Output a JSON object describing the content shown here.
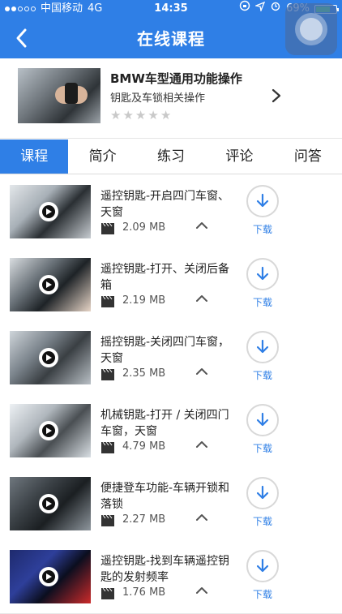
{
  "status_bar": {
    "carrier": "中国移动",
    "network": "4G",
    "time": "14:35",
    "battery": "69%",
    "battery_level": 0.69
  },
  "nav": {
    "title": "在线课程"
  },
  "course": {
    "title": "BMW车型通用功能操作",
    "subtitle": "钥匙及车锁相关操作",
    "rating": 0,
    "stars": [
      "★",
      "★",
      "★",
      "★",
      "★"
    ]
  },
  "tabs": [
    {
      "label": "课程",
      "active": true
    },
    {
      "label": "简介",
      "active": false
    },
    {
      "label": "练习",
      "active": false
    },
    {
      "label": "评论",
      "active": false
    },
    {
      "label": "问答",
      "active": false
    }
  ],
  "lessons": [
    {
      "title": "遥控钥匙-开启四门车窗、天窗",
      "size": "2.09 MB",
      "download_label": "下载"
    },
    {
      "title": "遥控钥匙-打开、关闭后备箱",
      "size": "2.19 MB",
      "download_label": "下载"
    },
    {
      "title": "摇控钥匙-关闭四门车窗，天窗",
      "size": "2.35 MB",
      "download_label": "下载"
    },
    {
      "title": "机械钥匙-打开 / 关闭四门车窗，天窗",
      "size": "4.79 MB",
      "download_label": "下载"
    },
    {
      "title": "便捷登车功能-车辆开锁和落锁",
      "size": "2.27 MB",
      "download_label": "下载"
    },
    {
      "title": "遥控钥匙-找到车辆遥控钥匙的发射频率",
      "size": "1.76 MB",
      "download_label": "下载"
    }
  ],
  "colors": {
    "primary": "#2f7fe6",
    "star_inactive": "#c9c9c9"
  },
  "icons": {
    "back": "back-arrow-icon",
    "chevron": "chevron-right-icon",
    "download": "download-arrow-icon",
    "film": "film-clapper-icon",
    "caret": "caret-up-icon",
    "play": "play-icon"
  }
}
